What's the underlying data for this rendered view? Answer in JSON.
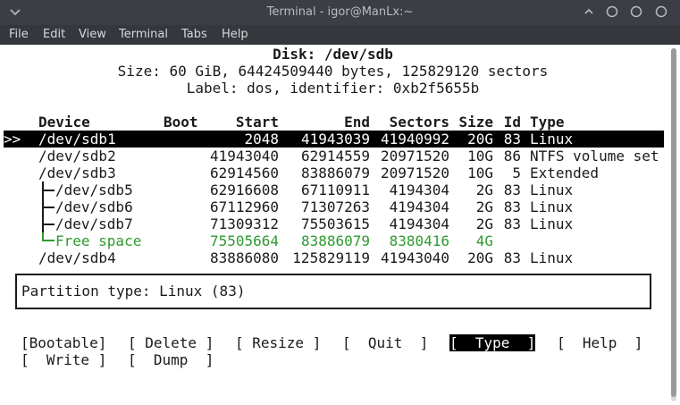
{
  "window": {
    "title": "Terminal - igor@ManLx:~",
    "menu": [
      "File",
      "Edit",
      "View",
      "Terminal",
      "Tabs",
      "Help"
    ]
  },
  "disk": {
    "title": "Disk: /dev/sdb",
    "size_line": "Size: 60 GiB, 64424509440 bytes, 125829120 sectors",
    "label_line": "Label: dos, identifier: 0xb2f5655b"
  },
  "table": {
    "headers": [
      "Device",
      "Boot",
      "Start",
      "End",
      "Sectors",
      "Size",
      "Id",
      "Type"
    ],
    "rows": [
      {
        "marker": ">>",
        "device": "/dev/sdb1",
        "boot": "",
        "start": "2048",
        "end": "41943039",
        "sectors": "41940992",
        "size": "20G",
        "id": "83",
        "type": "Linux"
      },
      {
        "marker": "",
        "device": "/dev/sdb2",
        "boot": "",
        "start": "41943040",
        "end": "62914559",
        "sectors": "20971520",
        "size": "10G",
        "id": "86",
        "type": "NTFS volume set"
      },
      {
        "marker": "",
        "device": "/dev/sdb3",
        "boot": "",
        "start": "62914560",
        "end": "83886079",
        "sectors": "20971520",
        "size": "10G",
        "id": "5",
        "type": "Extended"
      },
      {
        "marker": "",
        "device": "/dev/sdb5",
        "boot": "",
        "start": "62916608",
        "end": "67110911",
        "sectors": "4194304",
        "size": "2G",
        "id": "83",
        "type": "Linux"
      },
      {
        "marker": "",
        "device": "/dev/sdb6",
        "boot": "",
        "start": "67112960",
        "end": "71307263",
        "sectors": "4194304",
        "size": "2G",
        "id": "83",
        "type": "Linux"
      },
      {
        "marker": "",
        "device": "/dev/sdb7",
        "boot": "",
        "start": "71309312",
        "end": "75503615",
        "sectors": "4194304",
        "size": "2G",
        "id": "83",
        "type": "Linux"
      },
      {
        "marker": "",
        "device": "Free space",
        "boot": "",
        "start": "75505664",
        "end": "83886079",
        "sectors": "8380416",
        "size": "4G",
        "id": "",
        "type": ""
      },
      {
        "marker": "",
        "device": "/dev/sdb4",
        "boot": "",
        "start": "83886080",
        "end": "125829119",
        "sectors": "41943040",
        "size": "20G",
        "id": "83",
        "type": "Linux"
      }
    ]
  },
  "partition_type": "Partition type: Linux (83)",
  "buttons": [
    "[Bootable]",
    "[ Delete ]",
    "[ Resize ]",
    "[  Quit  ]",
    "[  Type  ]",
    "[  Help  ]",
    "[  Write ]",
    "[  Dump  ]"
  ],
  "colors": {
    "free_space": "#2e9a2e",
    "titlebar": "#3b3f45",
    "menubar": "#34383d"
  }
}
